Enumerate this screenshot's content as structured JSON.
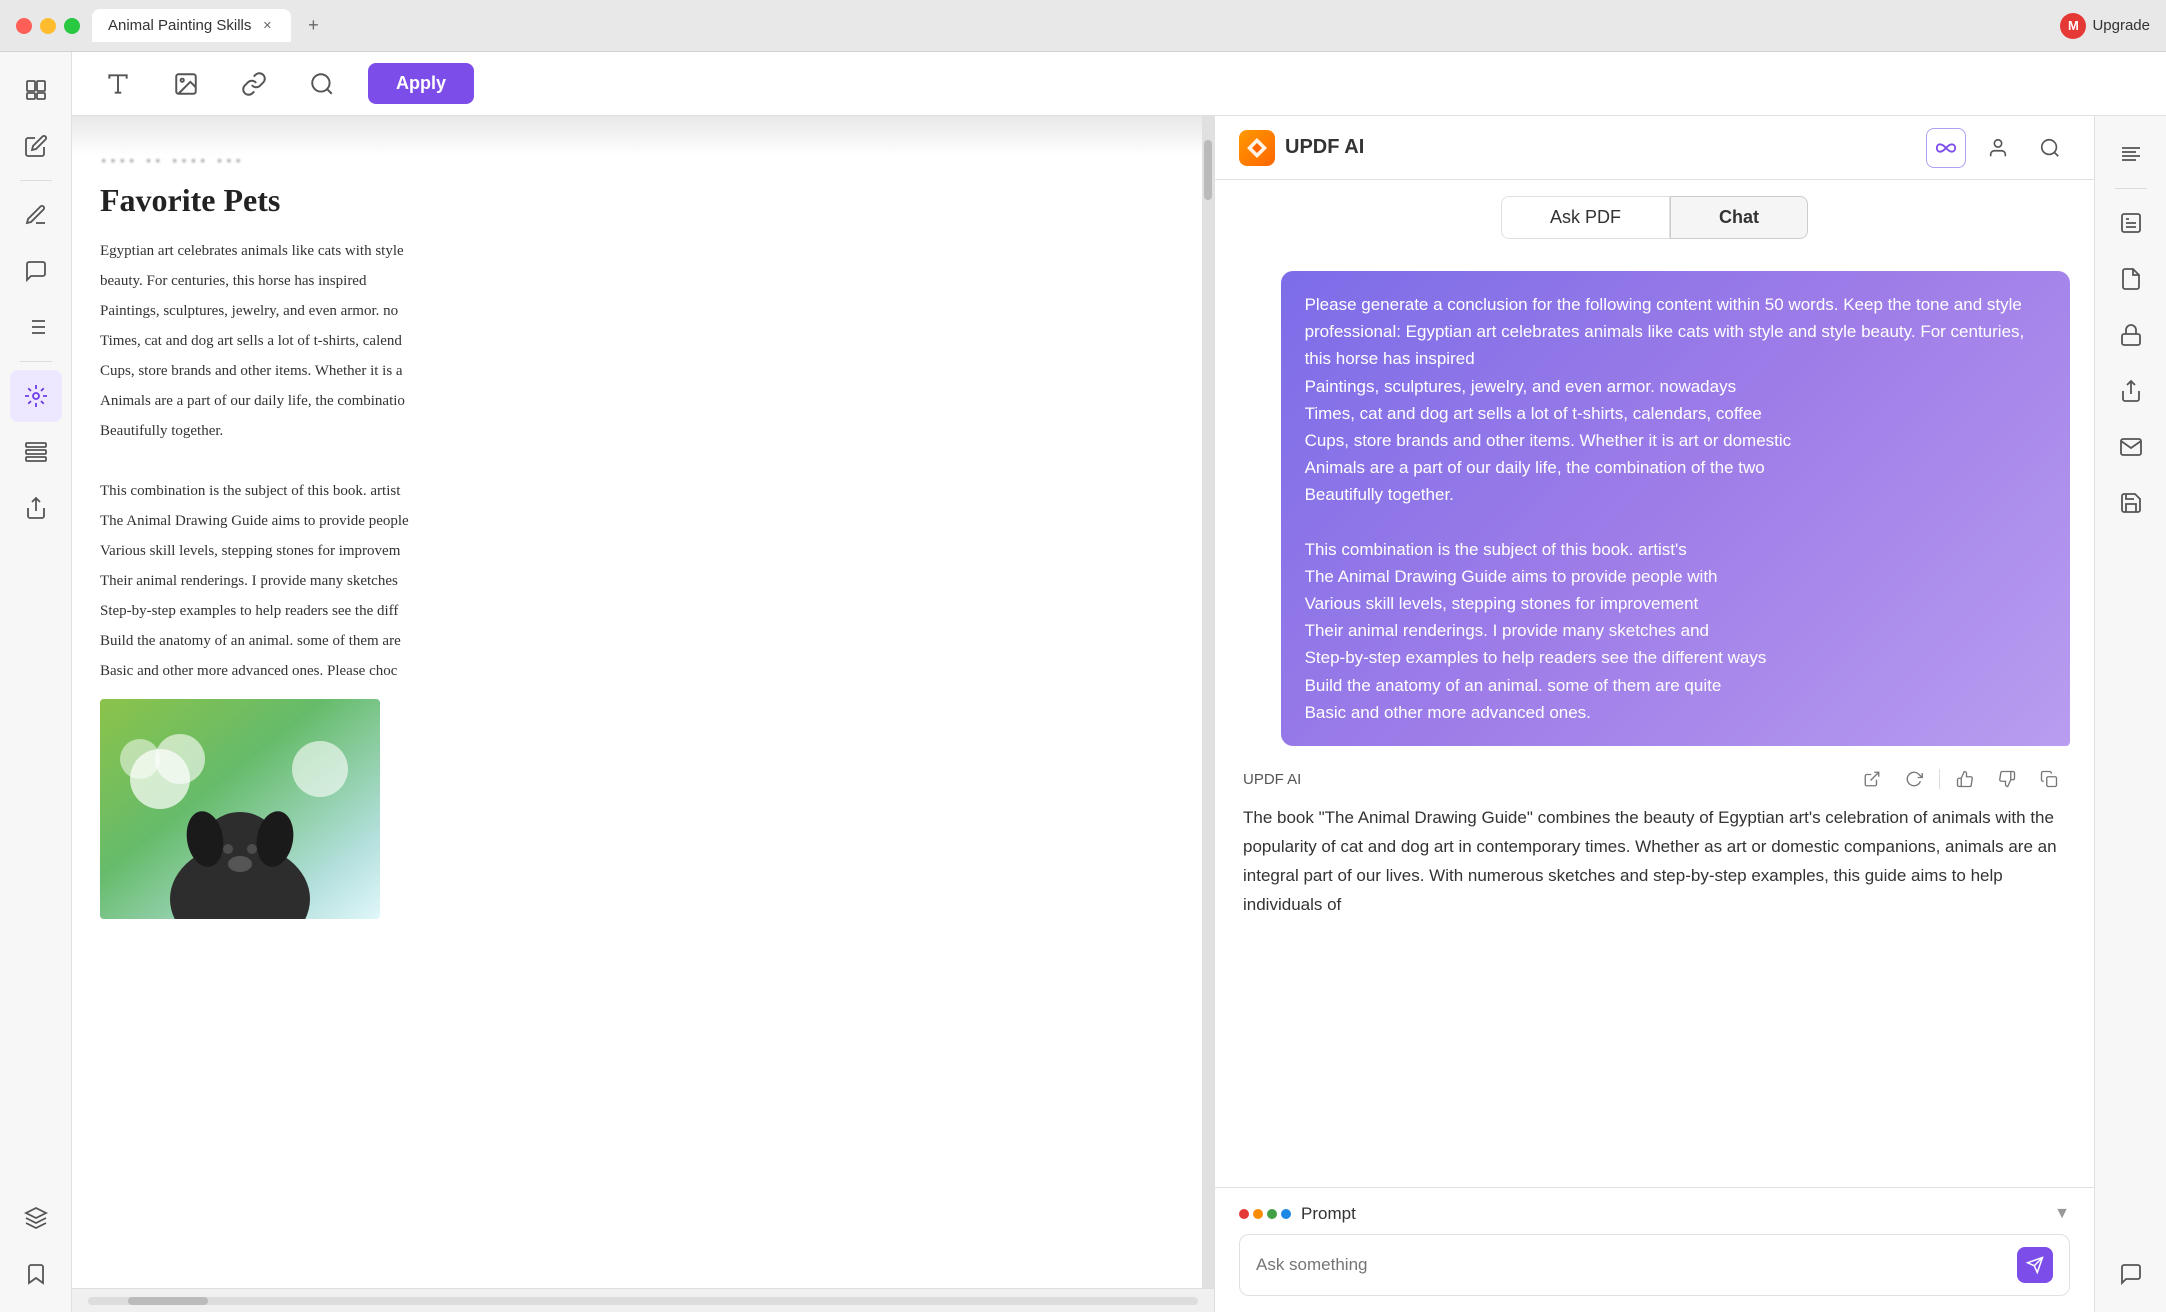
{
  "titlebar": {
    "tab_title": "Animal Painting Skills",
    "upgrade_label": "Upgrade"
  },
  "toolbar": {
    "apply_label": "Apply"
  },
  "pdf": {
    "title": "Favorite Pets",
    "paragraphs": [
      "Egyptian art celebrates animals like cats with style",
      "beauty. For centuries, this horse has inspired",
      "Paintings, sculptures, jewelry, and even armor. no",
      "Times, cat and dog art sells a lot of t-shirts, calend",
      "Cups, store brands and other items. Whether it is a",
      "Animals are a part of our daily life, the combinatio",
      "Beautifully together.",
      "",
      "This combination is the subject of this book. artist",
      "The Animal Drawing Guide aims to provide people",
      "Various skill levels, stepping stones for improvem",
      "Their animal renderings. I provide many sketches",
      "Step-by-step examples to help readers see the diff",
      "Build the anatomy of an animal. some of them are",
      "Basic and other more advanced ones. Please choc"
    ]
  },
  "ai_panel": {
    "logo_text": "UPDF AI",
    "tabs": {
      "ask_pdf": "Ask PDF",
      "chat": "Chat"
    },
    "active_tab": "chat",
    "user_message": "Please generate a conclusion for the following content within 50 words. Keep the tone and style professional: Egyptian art celebrates animals like cats with style and style beauty. For centuries, this horse has inspired\nPaintings, sculptures, jewelry, and even armor. nowadays\nTimes, cat and dog art sells a lot of t-shirts, calendars, coffee\nCups, store brands and other items. Whether it is art or domestic\nAnimals are a part of our daily life, the combination of the two\nBeautifully together.\n\nThis combination is the subject of this book. artist's\nThe Animal Drawing Guide aims to provide people with\nVarious skill levels, stepping stones for improvement\nTheir animal renderings. I provide many sketches and\nStep-by-step examples to help readers see the different ways\nBuild the anatomy of an animal. some of them are quite\nBasic and other more advanced ones.",
    "ai_name": "UPDF AI",
    "ai_response": "The book \"The Animal Drawing Guide\" combines the beauty of Egyptian art's celebration of animals with the popularity of cat and dog art in contemporary times. Whether as art or domestic companions, animals are an integral part of our lives. With numerous sketches and step-by-step examples, this guide aims to help individuals of",
    "prompt_label": "Prompt",
    "input_placeholder": "Ask something"
  }
}
